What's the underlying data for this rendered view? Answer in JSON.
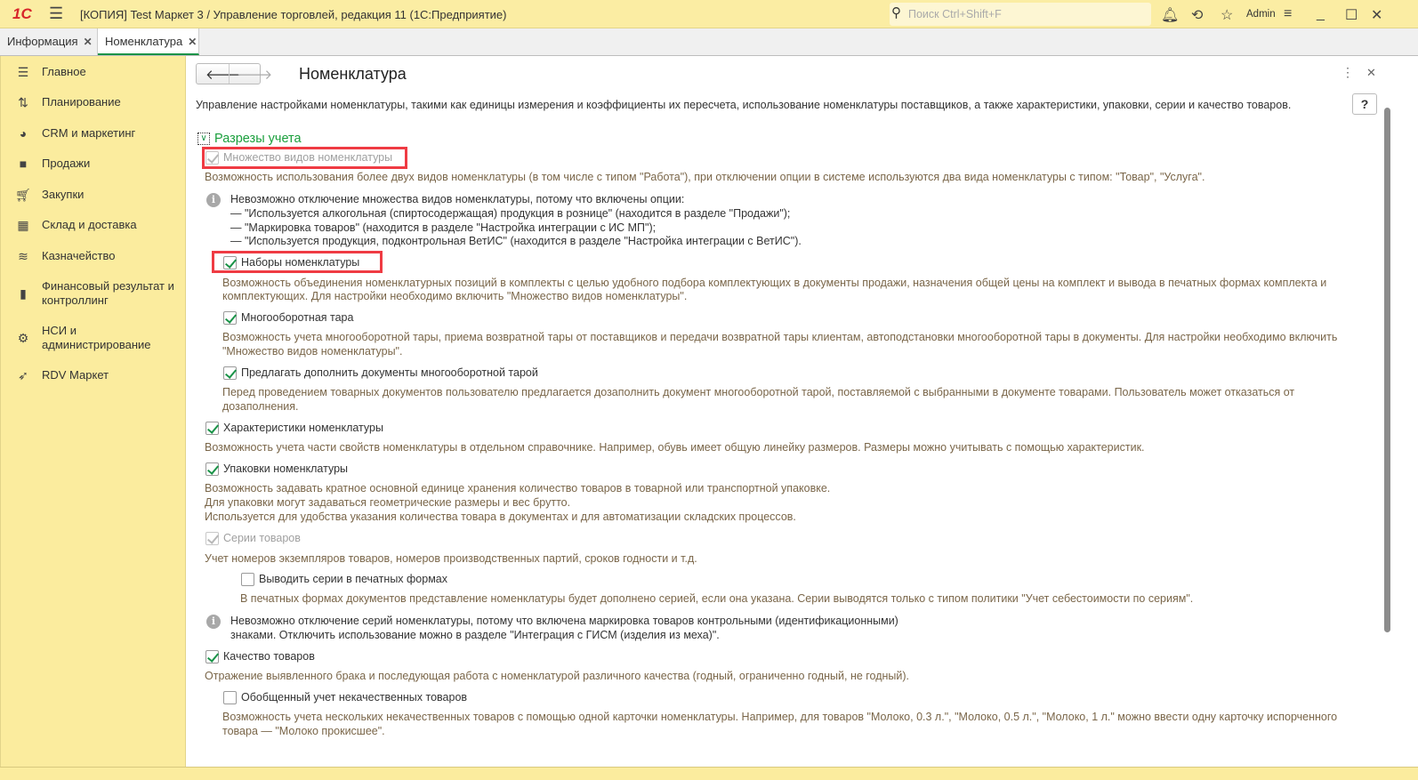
{
  "titlebar": {
    "logo": "1С",
    "title": "[КОПИЯ] Test Маркет 3 / Управление торговлей, редакция 11  (1С:Предприятие)",
    "search_placeholder": "Поиск Ctrl+Shift+F",
    "user": "Admin"
  },
  "tabs": [
    {
      "label": "Информация"
    },
    {
      "label": "Номенклатура"
    }
  ],
  "sidebar": {
    "items": [
      {
        "label": "Главное"
      },
      {
        "label": "Планирование"
      },
      {
        "label": "CRM и маркетинг"
      },
      {
        "label": "Продажи"
      },
      {
        "label": "Закупки"
      },
      {
        "label": "Склад и доставка"
      },
      {
        "label": "Казначейство"
      },
      {
        "label": "Финансовый результат и контроллинг"
      },
      {
        "label": "НСИ и администрирование"
      },
      {
        "label": "RDV Маркет"
      }
    ]
  },
  "form": {
    "title": "Номенклатура",
    "help": "?",
    "intro": "Управление настройками номенклатуры, такими как единицы измерения и коэффициенты их пересчета, использование номенклатуры поставщиков, а также характеристики, упаковки, серии и качество товаров.",
    "section": "Разрезы учета",
    "multi": {
      "label": "Множество видов номенклатуры",
      "desc": "Возможность использования более двух видов номенклатуры (в том числе с типом \"Работа\"), при отключении опции в системе используются два вида номенклатуры с типом: \"Товар\", \"Услуга\"."
    },
    "info1": [
      "Невозможно отключение множества видов номенклатуры, потому что включены опции:",
      "— \"Используется алкогольная (спиртосодержащая) продукция в рознице\" (находится в разделе \"Продажи\");",
      "— \"Маркировка товаров\" (находится в разделе \"Настройка интеграции с ИС МП\");",
      "— \"Используется продукция, подконтрольная ВетИС\" (находится в разделе \"Настройка интеграции с ВетИС\")."
    ],
    "sets": {
      "label": "Наборы номенклатуры",
      "desc": [
        "Возможность объединения номенклатурных позиций в комплекты с целью удобного подбора комплектующих в документы продажи, назначения общей цены на комплект и вывода в печатных формах комплекта и",
        "комплектующих. Для настройки необходимо включить \"Множество видов номенклатуры\"."
      ]
    },
    "tare": {
      "label": "Многооборотная тара",
      "desc": [
        "Возможность учета многооборотной тары, приема возвратной тары от поставщиков и передачи возвратной тары клиентам, автоподстановки многооборотной тары в документы. Для настройки необходимо включить",
        "\"Множество видов номенклатуры\"."
      ]
    },
    "offer_tare": {
      "label": "Предлагать дополнить документы многооборотной тарой",
      "desc": [
        "Перед проведением товарных документов пользователю предлагается дозаполнить документ многооборотной тарой, поставляемой с выбранными в документе товарами. Пользователь может отказаться от",
        "дозаполнения."
      ]
    },
    "chars": {
      "label": "Характеристики номенклатуры",
      "desc": "Возможность учета части свойств номенклатуры в отдельном справочнике. Например, обувь имеет общую линейку размеров. Размеры можно учитывать с помощью характеристик."
    },
    "packs": {
      "label": "Упаковки номенклатуры",
      "desc": [
        "Возможность задавать кратное основной единице хранения количество товаров в товарной или транспортной упаковке.",
        "Для упаковки могут задаваться геометрические размеры и вес брутто.",
        "Используется для удобства указания количества товара в документах и для автоматизации складских процессов."
      ]
    },
    "series": {
      "label": "Серии товаров",
      "desc": "Учет номеров экземпляров товаров, номеров производственных партий, сроков годности и т.д."
    },
    "print_series": {
      "label": "Выводить серии в печатных формах",
      "desc": "В печатных формах документов представление номенклатуры будет дополнено серией, если она указана. Серии выводятся только с типом политики \"Учет себестоимости по сериям\"."
    },
    "info2": [
      "Невозможно отключение серий номенклатуры, потому что включена маркировка товаров контрольными (идентификационными)",
      "знаками. Отключить использование можно в разделе \"Интеграция с ГИСМ (изделия из меха)\"."
    ],
    "quality": {
      "label": "Качество товаров",
      "desc": "Отражение выявленного брака и последующая работа с номенклатурой различного качества (годный, ограниченно годный, не годный)."
    },
    "defects": {
      "label": "Обобщенный учет некачественных товаров",
      "desc": [
        "Возможность учета нескольких некачественных товаров с помощью одной карточки номенклатуры. Например, для товаров \"Молоко, 0.3 л.\", \"Молоко, 0.5 л.\", \"Молоко, 1 л.\" можно ввести одну карточку испорченного",
        "товара — \"Молоко прокисшее\"."
      ]
    }
  }
}
